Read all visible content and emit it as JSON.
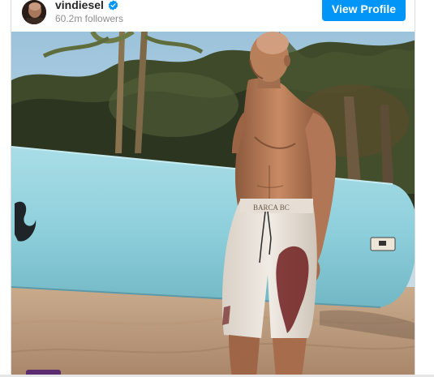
{
  "profile": {
    "username": "vindiesel",
    "followers": "60.2m followers",
    "verified_icon": "verified-badge-icon",
    "view_profile_label": "View Profile",
    "accent_color": "#0095f6"
  },
  "post": {
    "shorts_text": "BARCA BC"
  }
}
